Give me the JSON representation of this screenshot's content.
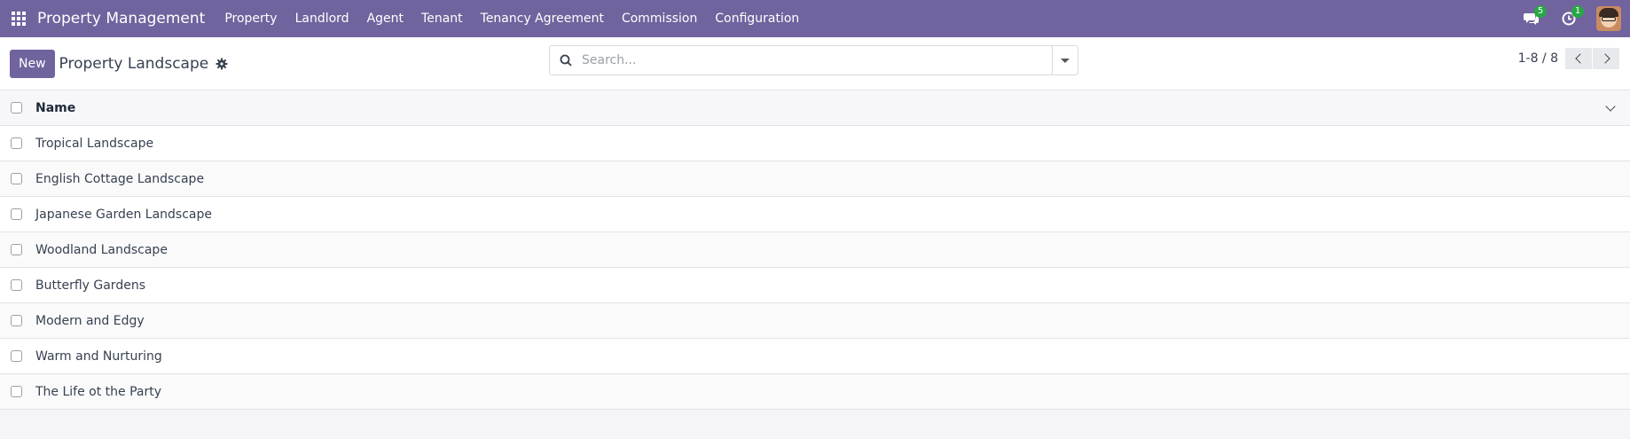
{
  "navbar": {
    "brand": "Property Management",
    "menu": [
      "Property",
      "Landlord",
      "Agent",
      "Tenant",
      "Tenancy Agreement",
      "Commission",
      "Configuration"
    ],
    "messages_count": "5",
    "activities_count": "1"
  },
  "control": {
    "new_label": "New",
    "title": "Property Landscape",
    "search_placeholder": "Search...",
    "pager": "1-8 / 8"
  },
  "list": {
    "column_name": "Name",
    "rows": [
      "Tropical Landscape",
      "English Cottage Landscape",
      "Japanese Garden Landscape",
      "Woodland Landscape",
      "Butterfly Gardens",
      "Modern and Edgy",
      "Warm and Nurturing",
      "The Life ot the Party"
    ]
  },
  "colors": {
    "navbar_bg": "#71639e",
    "primary_button": "#71639e",
    "badge": "#28a745"
  }
}
